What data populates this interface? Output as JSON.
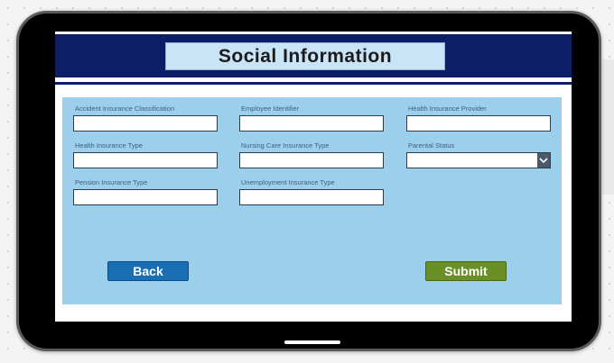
{
  "header": {
    "title": "Social Information"
  },
  "form": {
    "fields": [
      {
        "label": "Accident Insurance Classification",
        "value": ""
      },
      {
        "label": "Employee Identifier",
        "value": ""
      },
      {
        "label": "Health Insurance Provider",
        "value": ""
      },
      {
        "label": "Health Insurance Type",
        "value": ""
      },
      {
        "label": "Nursing Care Insurance Type",
        "value": ""
      },
      {
        "label": "Parental Status",
        "value": ""
      },
      {
        "label": "Pension Insurance Type",
        "value": ""
      },
      {
        "label": "Unemployment Insurance Type",
        "value": ""
      }
    ]
  },
  "buttons": {
    "back": "Back",
    "submit": "Submit"
  },
  "colors": {
    "header_bg": "#0c1f66",
    "title_bg": "#c9e4f7",
    "panel_bg": "#9ccfec",
    "back_button": "#1a6eb3",
    "submit_button": "#6b8f27"
  },
  "icons": {
    "dropdown": "chevron-down-icon"
  }
}
